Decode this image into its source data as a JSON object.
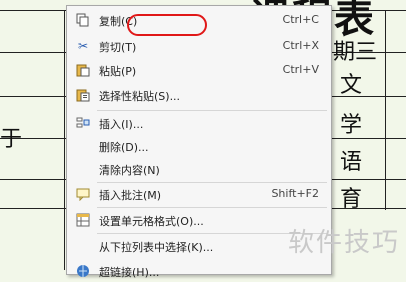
{
  "sheet": {
    "title": "课程表",
    "header_day": "期三",
    "column_cells": [
      "文",
      "学",
      "语",
      "育"
    ],
    "left_char": "于"
  },
  "menu": {
    "items": [
      {
        "label": "复制(C)",
        "shortcut": "Ctrl+C",
        "icon": "copy-icon"
      },
      {
        "label": "剪切(T)",
        "shortcut": "Ctrl+X",
        "icon": "cut-icon"
      },
      {
        "label": "粘贴(P)",
        "shortcut": "Ctrl+V",
        "icon": "paste-icon"
      },
      {
        "label": "选择性粘贴(S)...",
        "shortcut": "",
        "icon": "paste-special-icon"
      },
      {
        "label": "插入(I)...",
        "shortcut": "",
        "icon": "insert-icon"
      },
      {
        "label": "删除(D)...",
        "shortcut": "",
        "icon": ""
      },
      {
        "label": "清除内容(N)",
        "shortcut": "",
        "icon": ""
      },
      {
        "label": "插入批注(M)",
        "shortcut": "Shift+F2",
        "icon": "insert-comment-icon"
      },
      {
        "label": "设置单元格格式(O)...",
        "shortcut": "",
        "icon": "format-cells-icon"
      },
      {
        "label": "从下拉列表中选择(K)...",
        "shortcut": "",
        "icon": ""
      },
      {
        "label": "超链接(H)...",
        "shortcut": "",
        "icon": "hyperlink-icon"
      }
    ]
  },
  "watermark": "软件技巧",
  "colors": {
    "highlight": "#e01818",
    "background": "#f2f7e9"
  }
}
